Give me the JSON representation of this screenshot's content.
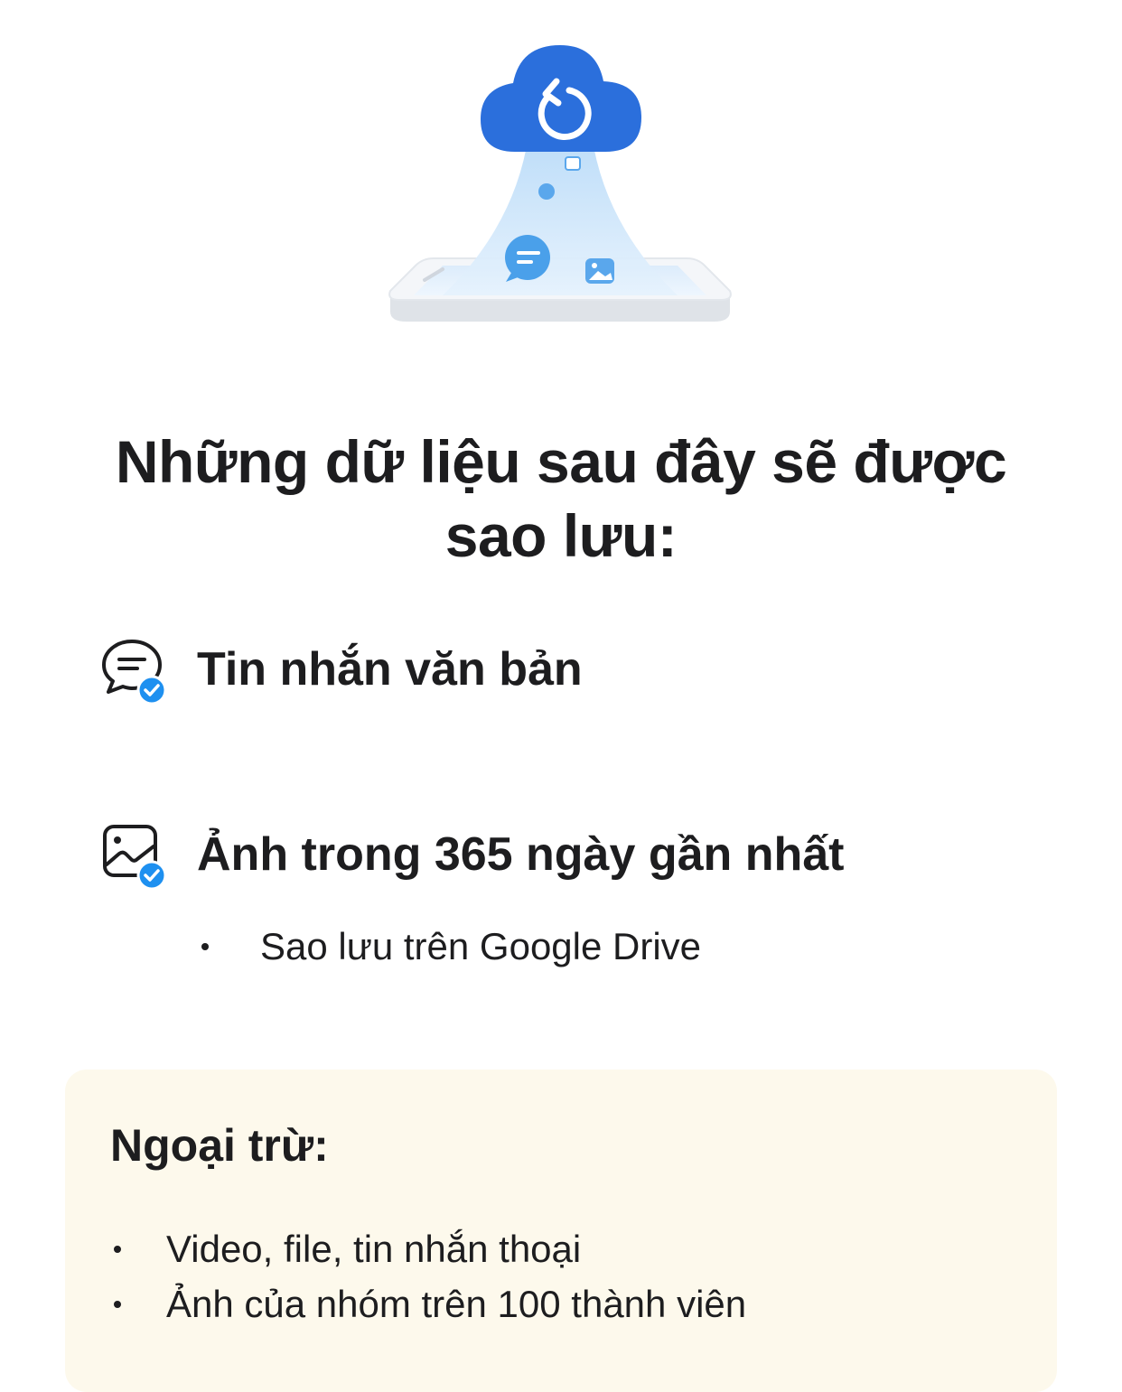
{
  "illustration": {
    "name": "cloud-backup-illustration",
    "accent_color": "#2b6fdc",
    "beam_color": "#cfe6fb"
  },
  "heading": {
    "title": "Những dữ liệu sau đây sẽ được sao lưu:"
  },
  "included_items": [
    {
      "icon": "message-check-icon",
      "label": "Tin nhắn văn bản"
    },
    {
      "icon": "photo-check-icon",
      "label": "Ảnh trong 365 ngày gần nhất"
    }
  ],
  "photo_details": [
    "Sao lưu trên Google Drive"
  ],
  "exceptions": {
    "title": "Ngoại trừ:",
    "items": [
      "Video, file, tin nhắn thoại",
      "Ảnh của nhóm trên 100 thành viên"
    ],
    "background_color": "#fdf9ec"
  },
  "colors": {
    "check_badge": "#1e90f0",
    "text": "#1d1d1f"
  }
}
